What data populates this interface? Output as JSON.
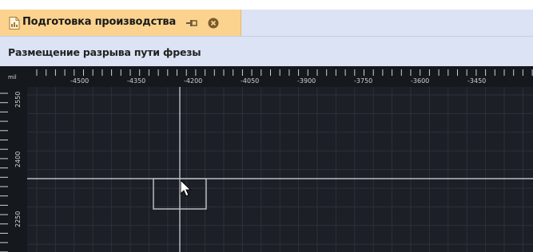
{
  "panel": {
    "title": "Подготовка производства",
    "icons": {
      "document": "document-icon",
      "pin": "pin-icon",
      "close": "close-icon"
    }
  },
  "header": {
    "text": "Размещение разрыва пути фрезы"
  },
  "canvas": {
    "unit": "mil",
    "x_ticks": [
      "-4500",
      "-4350",
      "-4200",
      "-4050",
      "-3900",
      "-3750",
      "-3600",
      "-3450"
    ],
    "y_ticks": [
      "2550",
      "2400",
      "2250"
    ],
    "colors": {
      "background": "#1c1f25",
      "grid": "#2c313a",
      "crosshair": "#d8dce2",
      "ruler_text": "#cfd3d8"
    }
  }
}
